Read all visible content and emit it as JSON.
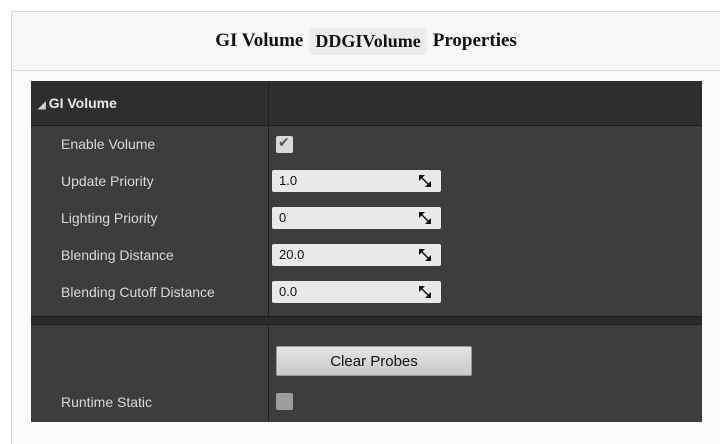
{
  "title": {
    "prefix": "GI Volume",
    "code": "DDGIVolume",
    "suffix": "Properties"
  },
  "category": {
    "label": "GI Volume",
    "expand_icon": "triangle-down-icon"
  },
  "properties": [
    {
      "label": "Enable Volume",
      "type": "checkbox",
      "checked": true
    },
    {
      "label": "Update Priority",
      "type": "number",
      "value": "1.0"
    },
    {
      "label": "Lighting Priority",
      "type": "number",
      "value": "0"
    },
    {
      "label": "Blending Distance",
      "type": "number",
      "value": "20.0"
    },
    {
      "label": "Blending Cutoff Distance",
      "type": "number",
      "value": "0.0"
    }
  ],
  "clear_button": {
    "label": "Clear Probes"
  },
  "runtime_static": {
    "label": "Runtime Static",
    "checked": false
  },
  "colors": {
    "panel_bg": "#3d3d3d",
    "header_bg": "#2e2e2e",
    "field_bg": "#e9e9e9"
  }
}
